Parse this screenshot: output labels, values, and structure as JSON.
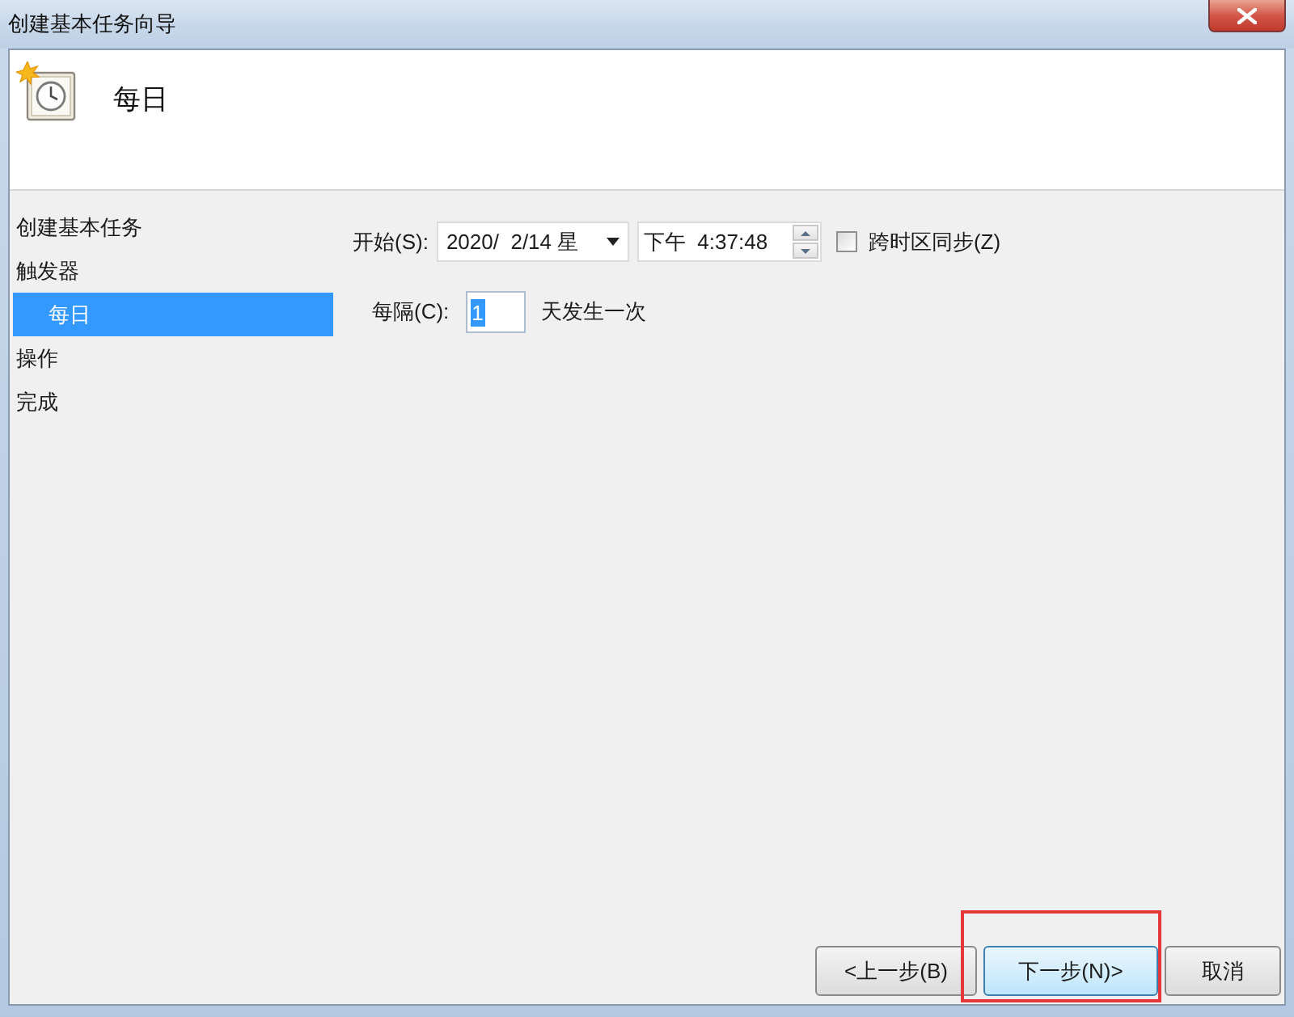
{
  "window": {
    "title": "创建基本任务向导"
  },
  "header": {
    "title": "每日"
  },
  "steps": [
    {
      "label": "创建基本任务",
      "selected": false
    },
    {
      "label": "触发器",
      "selected": false,
      "children": [
        {
          "label": "每日",
          "selected": true
        }
      ]
    },
    {
      "label": "操作",
      "selected": false
    },
    {
      "label": "完成",
      "selected": false
    }
  ],
  "start": {
    "label": "开始(S):",
    "date": "2020/  2/14 星",
    "time": "下午  4:37:48",
    "sync_time_zones": {
      "label": "跨时区同步(Z)",
      "checked": false
    }
  },
  "recur": {
    "label": "每隔(C):",
    "value": "1",
    "value_selected": true,
    "suffix": "天发生一次"
  },
  "buttons": [
    {
      "label": "<上一步(B)",
      "default": false,
      "highlighted": false
    },
    {
      "label": "下一步(N)>",
      "default": true,
      "highlighted": true
    },
    {
      "label": "取消",
      "default": false,
      "highlighted": false
    }
  ]
}
